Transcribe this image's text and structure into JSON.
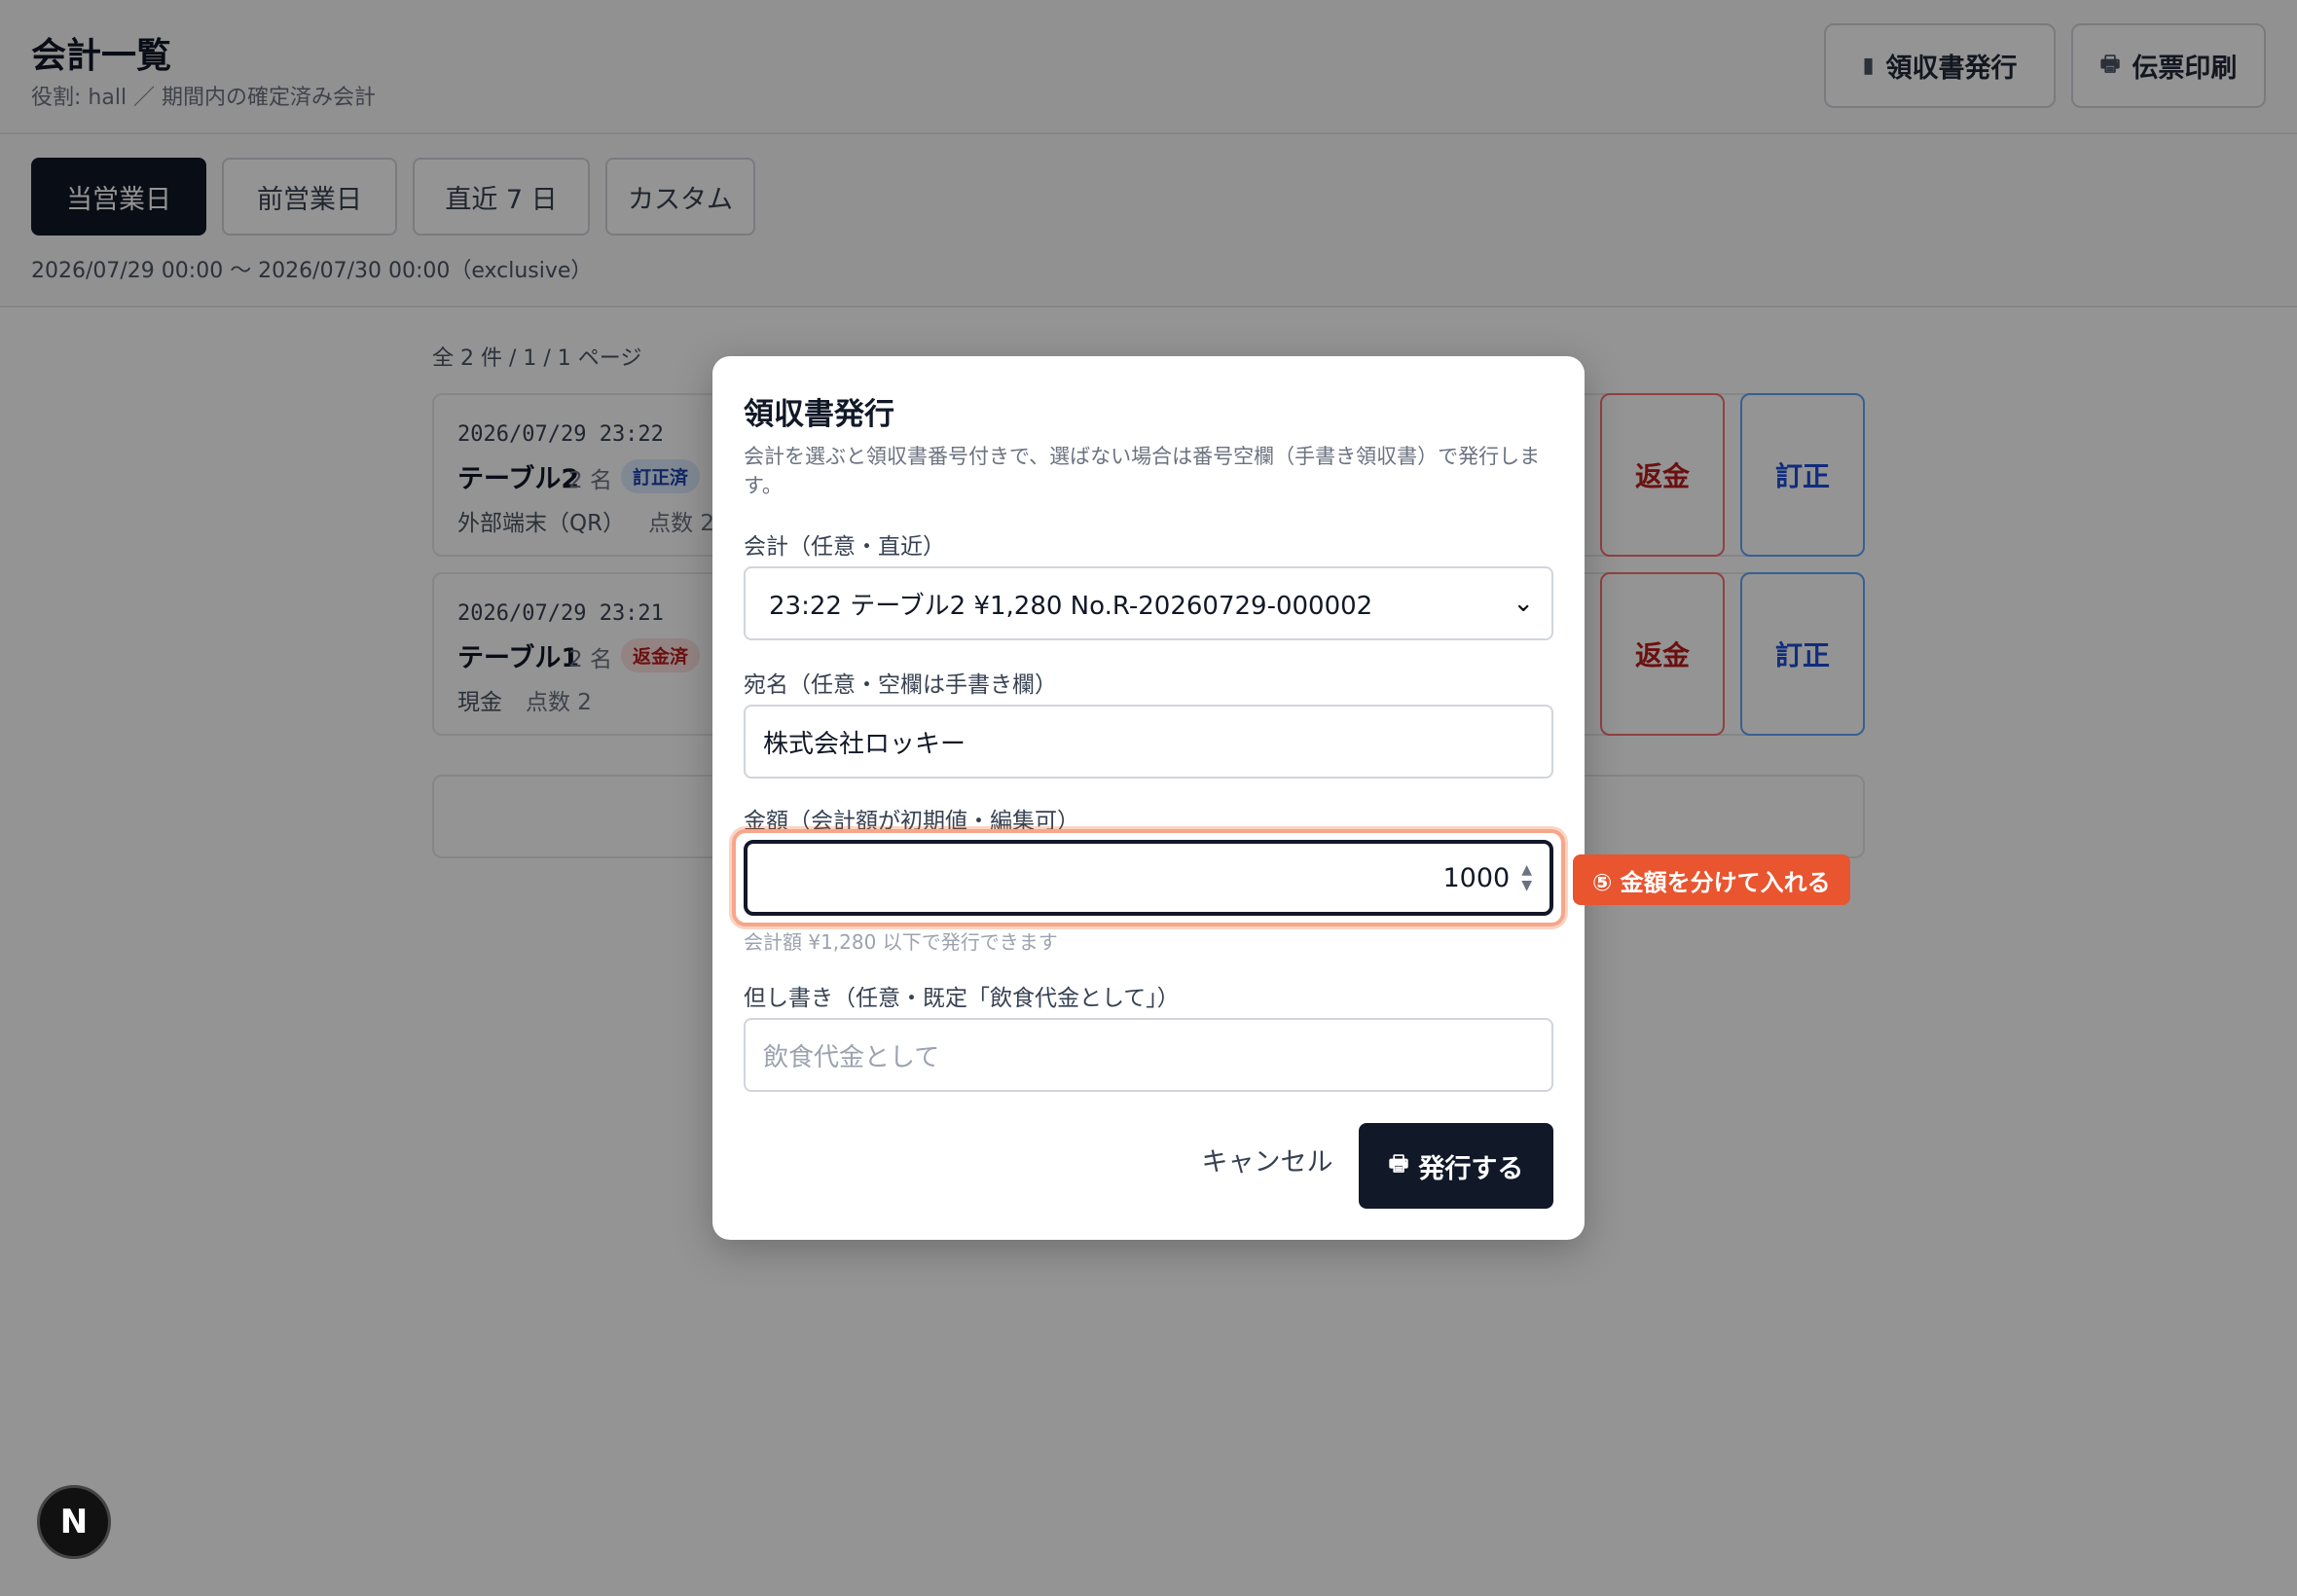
{
  "header": {
    "title": "会計一覧",
    "subtitle": "役割: hall ／ 期間内の確定済み会計",
    "receipt_button": "領収書発行",
    "slip_button": "伝票印刷"
  },
  "filters": {
    "ranges": [
      "当営業日",
      "前営業日",
      "直近 7 日",
      "カスタム"
    ],
    "active": "当営業日",
    "range_text": "2026/07/29 00:00 〜 2026/07/30 00:00（exclusive）"
  },
  "list": {
    "count_text": "全 2 件 / 1 / 1 ページ",
    "items": [
      {
        "time": "2026/07/29 23:22",
        "table": "テーブル2",
        "people": "2 名",
        "badge": "訂正済",
        "payment": "外部端末（QR）",
        "items": "点数 2",
        "refund_label": "返金",
        "correct_label": "訂正"
      },
      {
        "time": "2026/07/29 23:21",
        "table": "テーブル1",
        "people": "2 名",
        "badge": "返金済",
        "payment": "現金",
        "items": "点数 2",
        "refund_label": "返金",
        "correct_label": "訂正"
      }
    ]
  },
  "dialog": {
    "title": "領収書発行",
    "description": "会計を選ぶと領収書番号付きで、選ばない場合は番号空欄（手書き領収書）で発行します。",
    "account_label": "会計（任意・直近）",
    "account_value": "23:22 テーブル2 ¥1,280 No.R-20260729-000002",
    "name_label": "宛名（任意・空欄は手書き欄）",
    "name_value": "株式会社ロッキー",
    "amount_label": "金額（会計額が初期値・編集可）",
    "amount_value": "1000",
    "amount_hint": "会計額 ¥1,280 以下で発行できます",
    "note_label": "但し書き（任意・既定「飲食代金として」）",
    "note_placeholder": "飲食代金として",
    "cancel_label": "キャンセル",
    "issue_label": "発行する"
  },
  "callout": "⑤ 金額を分けて入れる",
  "next_badge": "N",
  "colors": {
    "primary": "#111827",
    "refund": "#b91c1c",
    "correct": "#1d4ed8",
    "callout": "#e8552f"
  }
}
